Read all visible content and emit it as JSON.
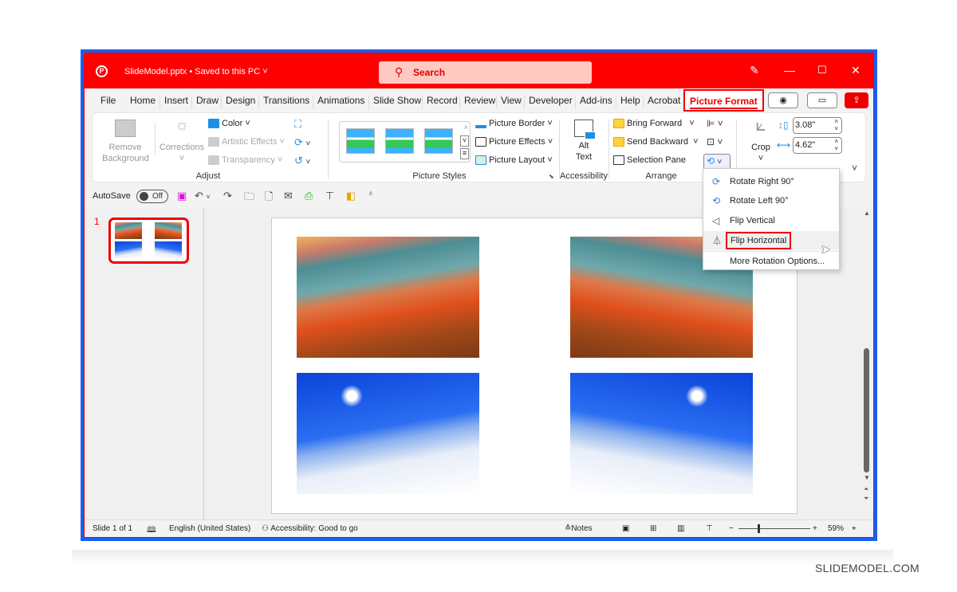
{
  "titlebar": {
    "filename": "SlideModel.pptx",
    "save_status": "Saved to this PC",
    "search_placeholder": "Search",
    "buttons": [
      "pen-icon",
      "minimize",
      "maximize",
      "close"
    ]
  },
  "tabs": [
    {
      "label": "File"
    },
    {
      "label": "Home"
    },
    {
      "label": "Insert"
    },
    {
      "label": "Draw"
    },
    {
      "label": "Design"
    },
    {
      "label": "Transitions"
    },
    {
      "label": "Animations"
    },
    {
      "label": "Slide Show"
    },
    {
      "label": "Record"
    },
    {
      "label": "Review"
    },
    {
      "label": "View"
    },
    {
      "label": "Developer"
    },
    {
      "label": "Add-ins"
    },
    {
      "label": "Help"
    },
    {
      "label": "Acrobat"
    },
    {
      "label": "Picture Format",
      "active": true
    }
  ],
  "ribbon": {
    "adjust": {
      "label": "Adjust",
      "remove_background": "Remove Background",
      "remove_background_l1": "Remove",
      "remove_background_l2": "Background",
      "corrections": "Corrections",
      "color": "Color",
      "artistic_effects": "Artistic Effects",
      "transparency": "Transparency"
    },
    "picture_styles": {
      "label": "Picture Styles",
      "picture_border": "Picture Border",
      "picture_effects": "Picture Effects",
      "picture_layout": "Picture Layout"
    },
    "accessibility": {
      "label": "Accessibility",
      "alt_text_l1": "Alt",
      "alt_text_l2": "Text"
    },
    "arrange": {
      "label": "Arrange",
      "bring_forward": "Bring Forward",
      "send_backward": "Send Backward",
      "selection_pane": "Selection Pane"
    },
    "size": {
      "crop": "Crop",
      "height": "3.08\"",
      "width": "4.62\""
    }
  },
  "rotate_menu": {
    "items": [
      {
        "label": "Rotate Right 90°",
        "icon": "rotate-right-icon"
      },
      {
        "label": "Rotate Left 90°",
        "icon": "rotate-left-icon"
      },
      {
        "label": "Flip Vertical",
        "icon": "flip-vertical-icon"
      },
      {
        "label": "Flip Horizontal",
        "icon": "flip-horizontal-icon",
        "highlighted": true
      },
      {
        "label": "More Rotation Options...",
        "icon": ""
      }
    ]
  },
  "qat": {
    "autosave_label": "AutoSave",
    "autosave_state": "Off"
  },
  "slides_panel": {
    "slide_number": "1"
  },
  "status": {
    "slide_info": "Slide 1 of 1",
    "language": "English (United States)",
    "accessibility": "Accessibility: Good to go",
    "notes": "Notes",
    "zoom": "59%",
    "zoom_value_percent": 59
  },
  "watermark": "SLIDEMODEL.COM"
}
